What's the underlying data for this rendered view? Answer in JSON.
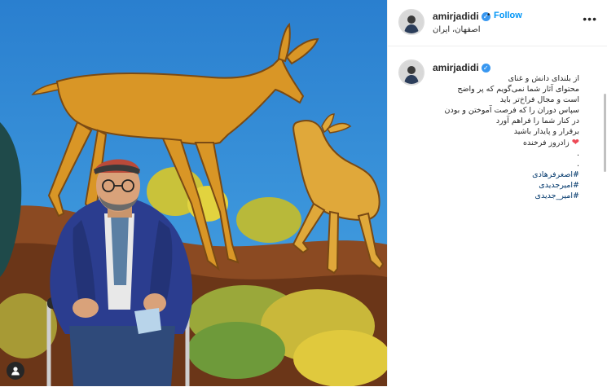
{
  "post": {
    "username": "amirjadidi",
    "location": "اصفهان، ایران",
    "follow_label": "Follow",
    "separator": "•",
    "more_label": "•••",
    "verified_mark": "✓"
  },
  "caption": {
    "lines": [
      "از بلندای دانش و غنای",
      "محتوای آثار شما نمی‌گویم که پر واضح",
      "است و مجال فراخ‌تر باید",
      "سپاس دوران را که فرصت آموختن و بودن",
      "در کنار شما را فراهم آورد",
      "برقرار و پایدار باشید",
      "زادروز فرخنده"
    ],
    "heart_emoji": "❤",
    "dots": [
      ".",
      "."
    ],
    "hashtags": [
      "#اصغرفرهادی",
      "#امیرجدیدی",
      "#امیر_جدیدی"
    ]
  },
  "colors": {
    "accent": "#0095f6",
    "verified": "#3897f0",
    "hashtag": "#00376b",
    "heart": "#ed4956",
    "sky": "#2f86cf"
  },
  "icons": {
    "user_tag": "person-icon",
    "more": "more-options-icon",
    "verified": "verified-badge-icon"
  }
}
